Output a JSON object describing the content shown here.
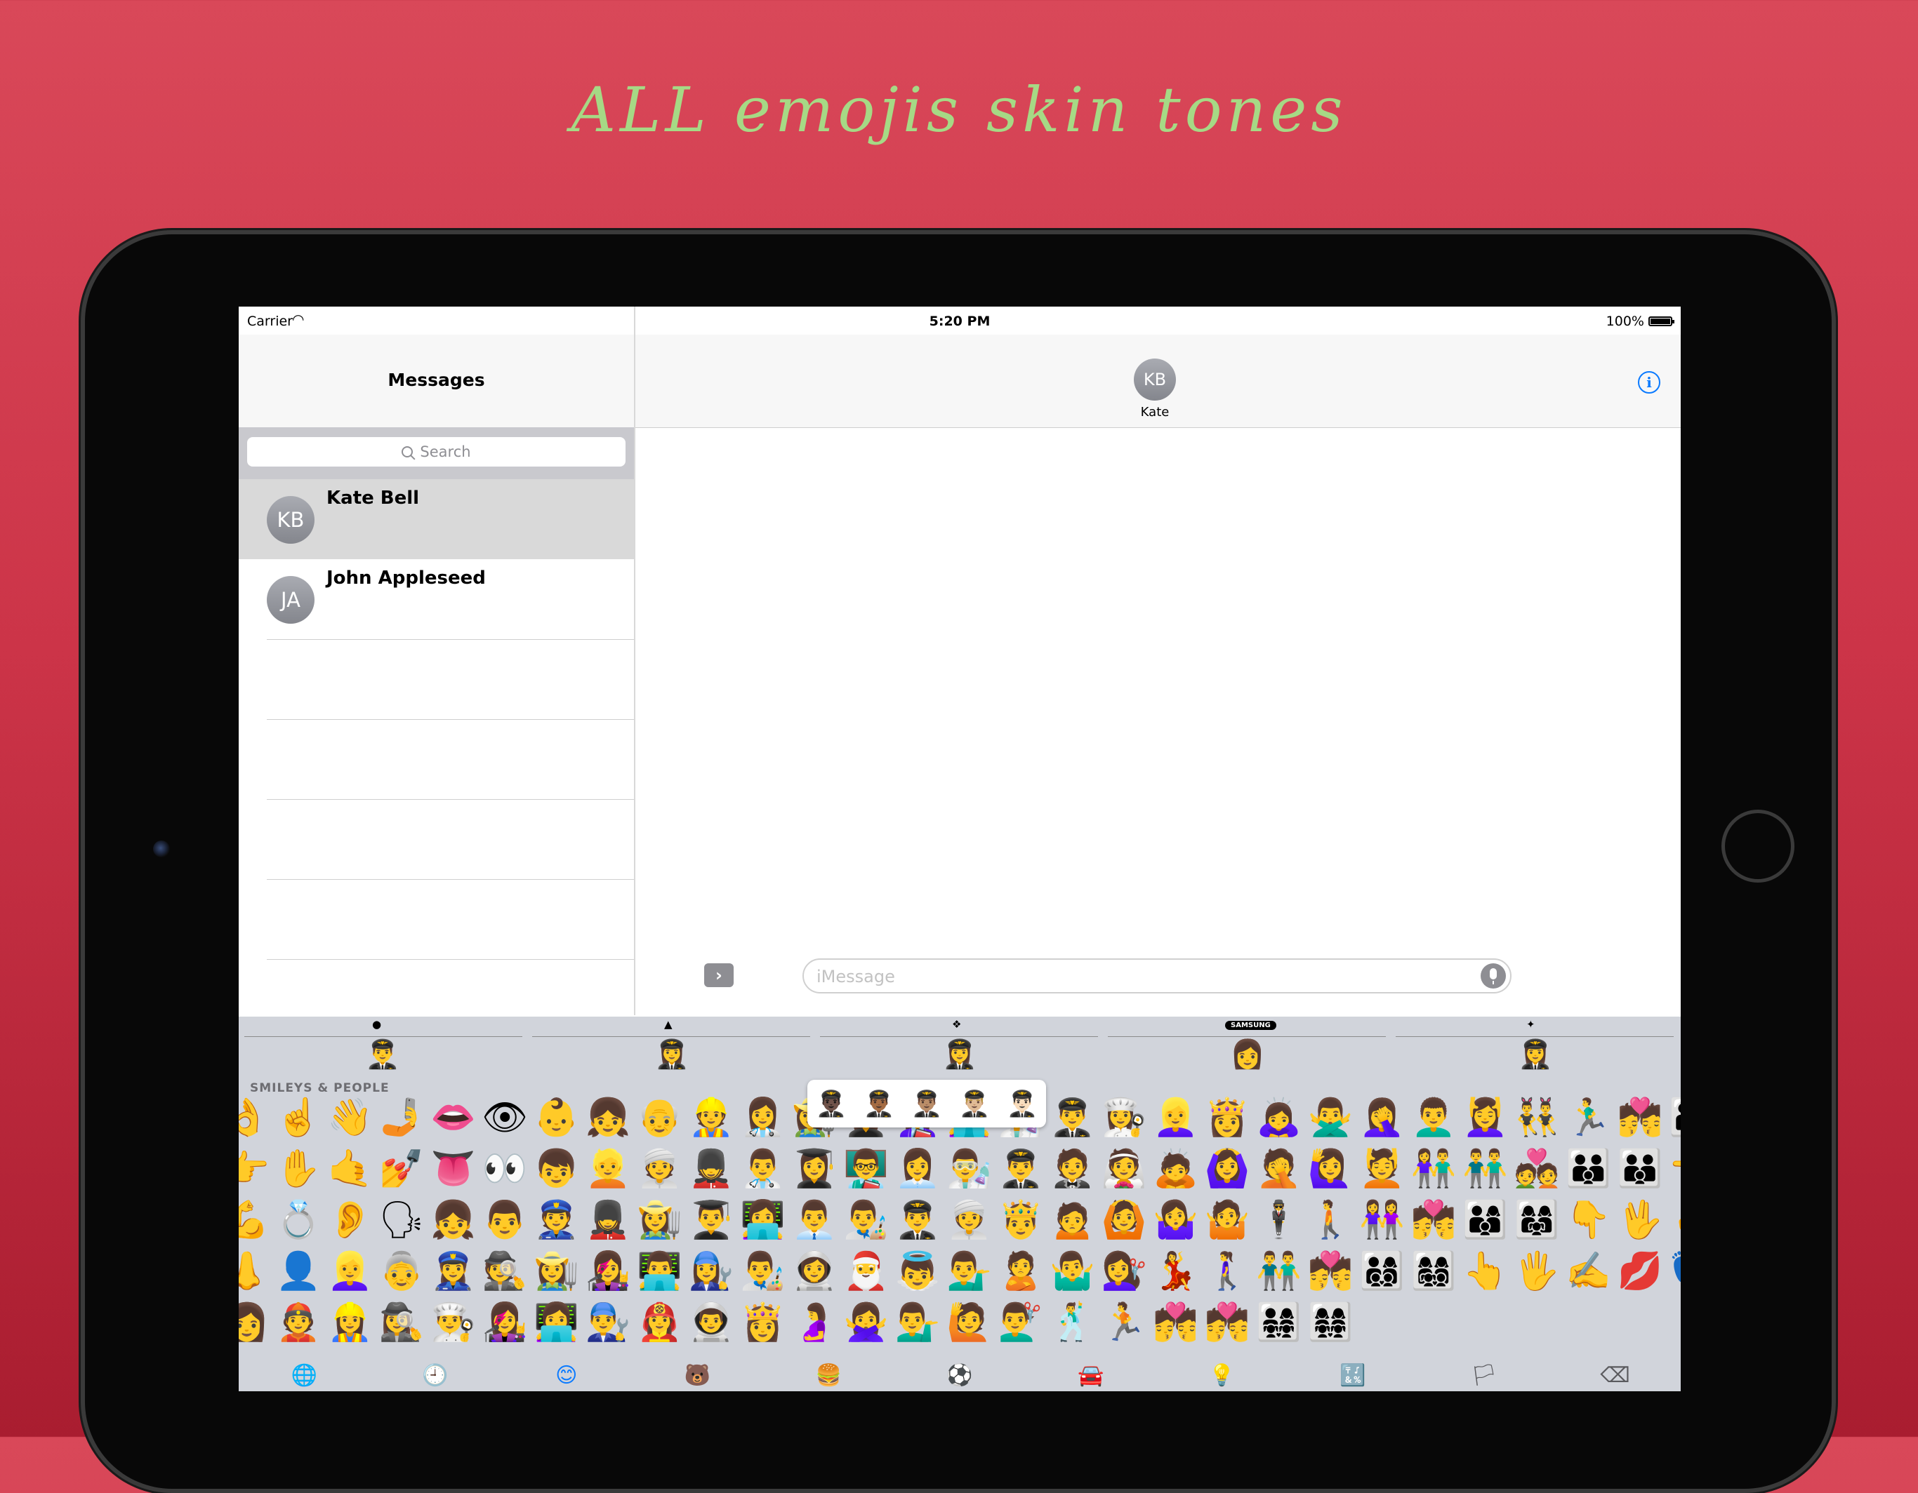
{
  "headline": "ALL emojis skin tones",
  "status": {
    "carrier": "Carrier",
    "time": "5:20 PM",
    "battery": "100%"
  },
  "left": {
    "title": "Messages",
    "search_placeholder": "Search",
    "conversations": [
      {
        "initials": "KB",
        "name": "Kate Bell"
      },
      {
        "initials": "JA",
        "name": "John Appleseed"
      }
    ]
  },
  "right": {
    "initials": "KB",
    "name": "Kate",
    "input_placeholder": "iMessage"
  },
  "keyboard": {
    "sources": [
      {
        "logo": "",
        "emoji": "👨‍✈️"
      },
      {
        "logo": "",
        "emoji": "👩‍✈️"
      },
      {
        "logo": "",
        "emoji": "👩‍✈️"
      },
      {
        "logo": "SAMSUNG",
        "emoji": "👩"
      },
      {
        "logo": "",
        "emoji": "👩‍✈️"
      }
    ],
    "category": "SMILEYS & PEOPLE",
    "popup": [
      "👨🏿‍✈️",
      "👨🏾‍✈️",
      "👨🏽‍✈️",
      "👨🏼‍✈️",
      "👨🏻‍✈️"
    ],
    "grid": "👌☝️👋🤳👄👁👶👧👴👷👩‍⚕️👩‍🌾👩‍🎓👩‍🏫👩‍💻👨‍🔬👨‍✈️👩‍🍳👱‍♀️👸🙇‍♀️🙅‍♂️🤦‍♀️👨‍🦱💆‍♀️👯‍♂️🏃‍♂️💏👨‍👩‍👧👩‍👩‍👦👉✋🤙💅👅👀👦👱👳💂👨‍⚕️👩‍🎓👨‍🏫👩‍💼👨‍🔬👨‍✈️🤵👰🙇🙆‍♀️🤦🙋‍♀️💆👫👬💑👪👨‍👨‍👦👈🤚💪💍👂🗣👧👨👮💂‍♀️👩‍🌾👨‍🎓👩‍💻👨‍💼👨‍🎨👨‍✈️👳‍♀️🤴🙍🙆🤷‍♀️🤷🕴🚶👭💏👨‍👩‍👦👩‍👩‍👧👇🖖🖕💄👃👤👱‍♀️👵👮‍♀️🕵️👩‍🌾👩‍🎤👨‍💻👩‍🔧👨‍🎨👩‍🚀🎅👼💁‍♂️🙎🤷‍♂️💇‍♀️💃🚶‍♀️👬💏👨‍👩‍👦‍👦👩‍👩‍👧‍👦👆🖐✍️💋👣👥👩👲👷‍♀️🕵️‍♀️👨‍🍳👩‍🎤👩‍💻👨‍🔧👩‍🚒👨‍🚀👸🤰🙅‍♀️💁‍♂️🙋💇‍♂️🕺🏃💏💏👨‍👩‍👧‍👧👩‍👩‍👧‍👧",
    "bottom": [
      "🌐",
      "🕘",
      "😊",
      "🐻",
      "🍔",
      "⚽",
      "🚘",
      "💡",
      "🔣",
      "🏳",
      "⌫"
    ]
  }
}
